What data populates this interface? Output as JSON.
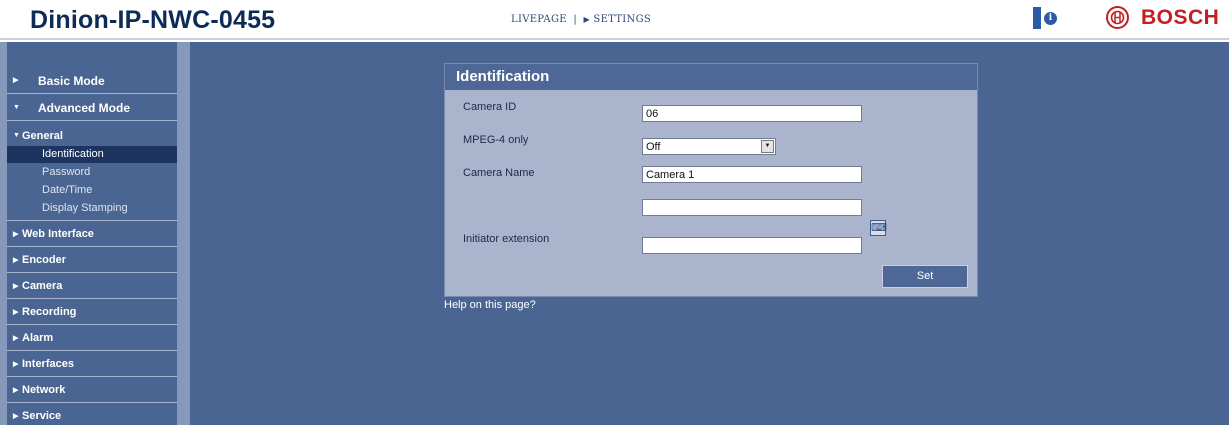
{
  "header": {
    "device_title": "Dinion-IP-NWC-0455",
    "nav_livepage": "LIVEPAGE",
    "nav_separator": "|",
    "nav_settings": "SETTINGS",
    "brand": "BOSCH",
    "help_icon_glyph": "i",
    "brand_color": "#c41e24"
  },
  "sidebar": {
    "basic_mode": "Basic Mode",
    "advanced_mode": "Advanced Mode",
    "general": "General",
    "general_items": [
      "Identification",
      "Password",
      "Date/Time",
      "Display Stamping"
    ],
    "active_item": "Identification",
    "sections": [
      "Web Interface",
      "Encoder",
      "Camera",
      "Recording",
      "Alarm",
      "Interfaces",
      "Network",
      "Service"
    ]
  },
  "panel": {
    "title": "Identification",
    "camera_id_label": "Camera ID",
    "camera_id_value": "06",
    "mpeg4_label": "MPEG-4 only",
    "mpeg4_value": "Off",
    "camera_name_label": "Camera Name",
    "camera_name_value": "Camera 1",
    "camera_name2_value": "",
    "ime_icon": "text-input-icon",
    "initiator_label": "Initiator extension",
    "initiator_value": "",
    "set_button": "Set"
  },
  "help_link": "Help on this page?",
  "colors": {
    "background": "#4a6591",
    "panel": "#aab5cd",
    "title_text": "#0d2b57"
  }
}
